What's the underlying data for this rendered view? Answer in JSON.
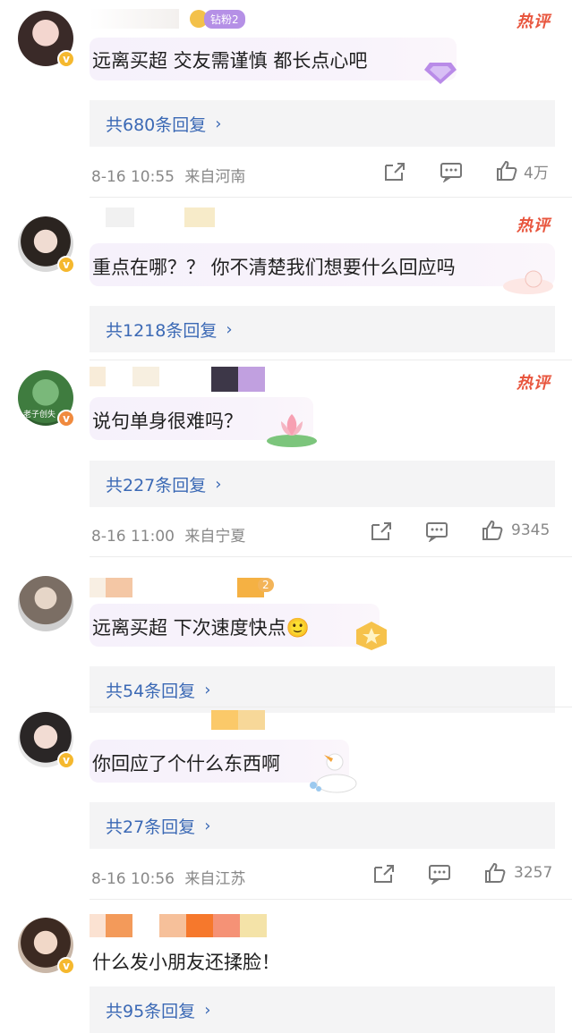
{
  "comments": [
    {
      "badge": "钻粉2",
      "hot": "热评",
      "text": "远离买超 交友需谨慎 都长点心吧",
      "replies": "共680条回复",
      "time": "8-16 10:55",
      "location": "来自河南",
      "likes": "4万"
    },
    {
      "hot": "热评",
      "text": "重点在哪？？ 你不清楚我们想要什么回应吗",
      "replies": "共1218条回复"
    },
    {
      "hot": "热评",
      "avatar_text": "老子创失",
      "text": "说句单身很难吗？",
      "replies": "共227条回复",
      "time": "8-16 11:00",
      "location": "来自宁夏",
      "likes": "9345"
    },
    {
      "level": "2",
      "text": "远离买超 下次速度快点🙂",
      "replies": "共54条回复"
    },
    {
      "text": "你回应了个什么东西啊",
      "replies": "共27条回复",
      "time": "8-16 10:56",
      "location": "来自江苏",
      "likes": "3257"
    },
    {
      "text": "什么发小朋友还揉脸！",
      "replies": "共95条回复"
    }
  ],
  "icons": {
    "chevron": "chevron-right-icon",
    "share": "share-icon",
    "comment": "comment-icon",
    "like": "like-icon",
    "verified": "verified-badge-icon"
  },
  "colors": {
    "hot": "#e8553d",
    "link": "#3b69b5",
    "meta": "#888888",
    "verified": "#f5b82e"
  }
}
